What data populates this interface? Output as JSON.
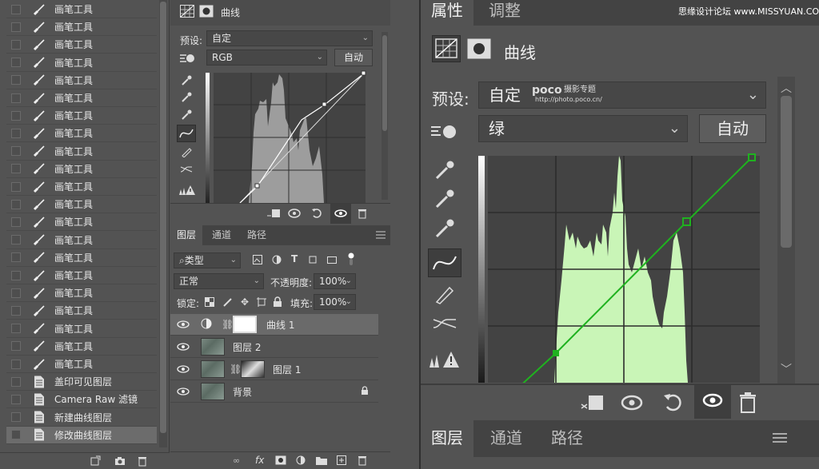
{
  "history": {
    "items": [
      {
        "label": "画笔工具",
        "icon": "brush"
      },
      {
        "label": "画笔工具",
        "icon": "brush"
      },
      {
        "label": "画笔工具",
        "icon": "brush"
      },
      {
        "label": "画笔工具",
        "icon": "brush"
      },
      {
        "label": "画笔工具",
        "icon": "brush"
      },
      {
        "label": "画笔工具",
        "icon": "brush"
      },
      {
        "label": "画笔工具",
        "icon": "brush"
      },
      {
        "label": "画笔工具",
        "icon": "brush"
      },
      {
        "label": "画笔工具",
        "icon": "brush"
      },
      {
        "label": "画笔工具",
        "icon": "brush"
      },
      {
        "label": "画笔工具",
        "icon": "brush"
      },
      {
        "label": "画笔工具",
        "icon": "brush"
      },
      {
        "label": "画笔工具",
        "icon": "brush"
      },
      {
        "label": "画笔工具",
        "icon": "brush"
      },
      {
        "label": "画笔工具",
        "icon": "brush"
      },
      {
        "label": "画笔工具",
        "icon": "brush"
      },
      {
        "label": "画笔工具",
        "icon": "brush"
      },
      {
        "label": "画笔工具",
        "icon": "brush"
      },
      {
        "label": "画笔工具",
        "icon": "brush"
      },
      {
        "label": "画笔工具",
        "icon": "brush"
      },
      {
        "label": "画笔工具",
        "icon": "brush"
      },
      {
        "label": "盖印可见图层",
        "icon": "doc"
      },
      {
        "label": "Camera Raw 滤镜",
        "icon": "doc"
      },
      {
        "label": "新建曲线图层",
        "icon": "doc"
      },
      {
        "label": "修改曲线图层",
        "icon": "doc",
        "selected": true
      }
    ]
  },
  "props_small": {
    "title": "曲线",
    "preset_label": "预设:",
    "preset_value": "自定",
    "channel_value": "RGB",
    "auto_label": "自动"
  },
  "layers": {
    "tabs": [
      "图层",
      "通道",
      "路径"
    ],
    "filter_value": "类型",
    "blend_value": "正常",
    "opacity_label": "不透明度:",
    "opacity_value": "100%",
    "lock_label": "锁定:",
    "fill_label": "填充:",
    "fill_value": "100%",
    "rows": [
      {
        "name": "曲线 1",
        "selected": true
      },
      {
        "name": "图层 2"
      },
      {
        "name": "图层 1"
      },
      {
        "name": "背景"
      }
    ]
  },
  "props_big": {
    "tabs": [
      "属性",
      "调整"
    ],
    "title": "曲线",
    "preset_label": "预设:",
    "preset_value": "自定",
    "channel_value": "绿",
    "auto_label": "自动",
    "watermark_brand": "poco",
    "watermark_text": "摄影专题",
    "watermark_url": "http://photo.poco.cn/"
  },
  "bottom_tabs": [
    "图层",
    "通道",
    "路径"
  ],
  "site_watermark": "思缘设计论坛 www.MISSYUAN.COM",
  "colors": {
    "accent_green": "#1fb21f",
    "histogram_green": "#c9f5b7",
    "histogram_gray": "#9a9a9a"
  }
}
